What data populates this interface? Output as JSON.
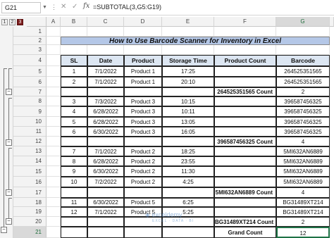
{
  "formula_bar": {
    "name_box": "G21",
    "formula": "=SUBTOTAL(3,G5:G19)"
  },
  "outline_levels": [
    "1",
    "2",
    "3"
  ],
  "columns": [
    "A",
    "B",
    "C",
    "D",
    "E",
    "F",
    "G"
  ],
  "rows": [
    "1",
    "2",
    "3",
    "4",
    "5",
    "6",
    "7",
    "8",
    "9",
    "10",
    "11",
    "12",
    "13",
    "14",
    "15",
    "16",
    "17",
    "18",
    "19",
    "20",
    "21"
  ],
  "title": "How to Use Barcode Scanner for Inventory in Excel",
  "table_headers": [
    "SL",
    "Date",
    "Product",
    "Storage Time",
    "Product Count",
    "Barcode"
  ],
  "table_rows": [
    {
      "row": "5",
      "sl": "1",
      "date": "7/1/2022",
      "product": "Product 1",
      "time": "17:25",
      "count": "",
      "barcode": "264525351565"
    },
    {
      "row": "6",
      "sl": "2",
      "date": "7/1/2022",
      "product": "Product 1",
      "time": "20:10",
      "count": "",
      "barcode": "264525351565"
    },
    {
      "row": "7",
      "sl": "",
      "date": "",
      "product": "",
      "time": "",
      "count": "264525351565 Count",
      "barcode": "2"
    },
    {
      "row": "8",
      "sl": "3",
      "date": "7/3/2022",
      "product": "Product 3",
      "time": "10:15",
      "count": "",
      "barcode": "396587456325"
    },
    {
      "row": "9",
      "sl": "4",
      "date": "6/28/2022",
      "product": "Product 3",
      "time": "10:11",
      "count": "",
      "barcode": "396587456325"
    },
    {
      "row": "10",
      "sl": "5",
      "date": "6/28/2022",
      "product": "Product 3",
      "time": "13:05",
      "count": "",
      "barcode": "396587456325"
    },
    {
      "row": "11",
      "sl": "6",
      "date": "6/30/2022",
      "product": "Product 3",
      "time": "16:05",
      "count": "",
      "barcode": "396587456325"
    },
    {
      "row": "12",
      "sl": "",
      "date": "",
      "product": "",
      "time": "",
      "count": "396587456325 Count",
      "barcode": "4"
    },
    {
      "row": "13",
      "sl": "7",
      "date": "7/1/2022",
      "product": "Product 2",
      "time": "18:25",
      "count": "",
      "barcode": "5MI632AN6889"
    },
    {
      "row": "14",
      "sl": "8",
      "date": "6/28/2022",
      "product": "Product 2",
      "time": "23:55",
      "count": "",
      "barcode": "5MI632AN6889"
    },
    {
      "row": "15",
      "sl": "9",
      "date": "6/30/2022",
      "product": "Product 2",
      "time": "11:30",
      "count": "",
      "barcode": "5MI632AN6889"
    },
    {
      "row": "16",
      "sl": "10",
      "date": "7/2/2022",
      "product": "Product 2",
      "time": "4:25",
      "count": "",
      "barcode": "5MI632AN6889"
    },
    {
      "row": "17",
      "sl": "",
      "date": "",
      "product": "",
      "time": "",
      "count": "5MI632AN6889 Count",
      "barcode": "4"
    },
    {
      "row": "18",
      "sl": "11",
      "date": "6/30/2022",
      "product": "Product 5",
      "time": "6:25",
      "count": "",
      "barcode": "BG31489XT214"
    },
    {
      "row": "19",
      "sl": "12",
      "date": "7/1/2022",
      "product": "Product 5",
      "time": "5:25",
      "count": "",
      "barcode": "BG31489XT214"
    },
    {
      "row": "20",
      "sl": "",
      "date": "",
      "product": "",
      "time": "",
      "count": "BG31489XT214 Count",
      "barcode": "2"
    },
    {
      "row": "21",
      "sl": "",
      "date": "",
      "product": "",
      "time": "",
      "count": "Grand Count",
      "barcode": "12"
    }
  ],
  "watermark": {
    "brand": "exceldemy",
    "tagline": "EXCEL · DATA · BI"
  },
  "selected_cell": "G21"
}
